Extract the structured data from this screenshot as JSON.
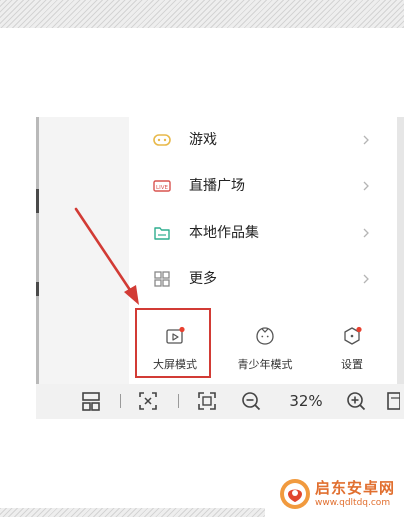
{
  "colors": {
    "accent_red": "#d23b35",
    "game_icon": "#e8b94a",
    "live_icon": "#d9534f",
    "local_icon": "#2fae8f",
    "more_icon": "#888888",
    "badge": "#e8402f",
    "watermark": "#e16f2f"
  },
  "menu": {
    "items": [
      {
        "label": "游戏",
        "icon": "gamepad-icon"
      },
      {
        "label": "直播广场",
        "icon": "live-icon"
      },
      {
        "label": "本地作品集",
        "icon": "folder-icon"
      },
      {
        "label": "更多",
        "icon": "grid-icon"
      }
    ]
  },
  "bottom": {
    "big_screen": {
      "label": "大屏模式",
      "icon": "big-screen-icon"
    },
    "teen": {
      "label": "青少年模式",
      "icon": "teen-face-icon"
    },
    "settings": {
      "label": "设置",
      "icon": "settings-hexagon-icon"
    }
  },
  "toolbar": {
    "zoom_level": "32%",
    "icons": [
      "fit-page-icon",
      "crop-icon",
      "fullscreen-icon",
      "zoom-out-icon",
      "zoom-in-icon",
      "page-icon"
    ]
  },
  "watermark": {
    "title": "启东安卓网",
    "url": "www.qdltdq.com"
  }
}
